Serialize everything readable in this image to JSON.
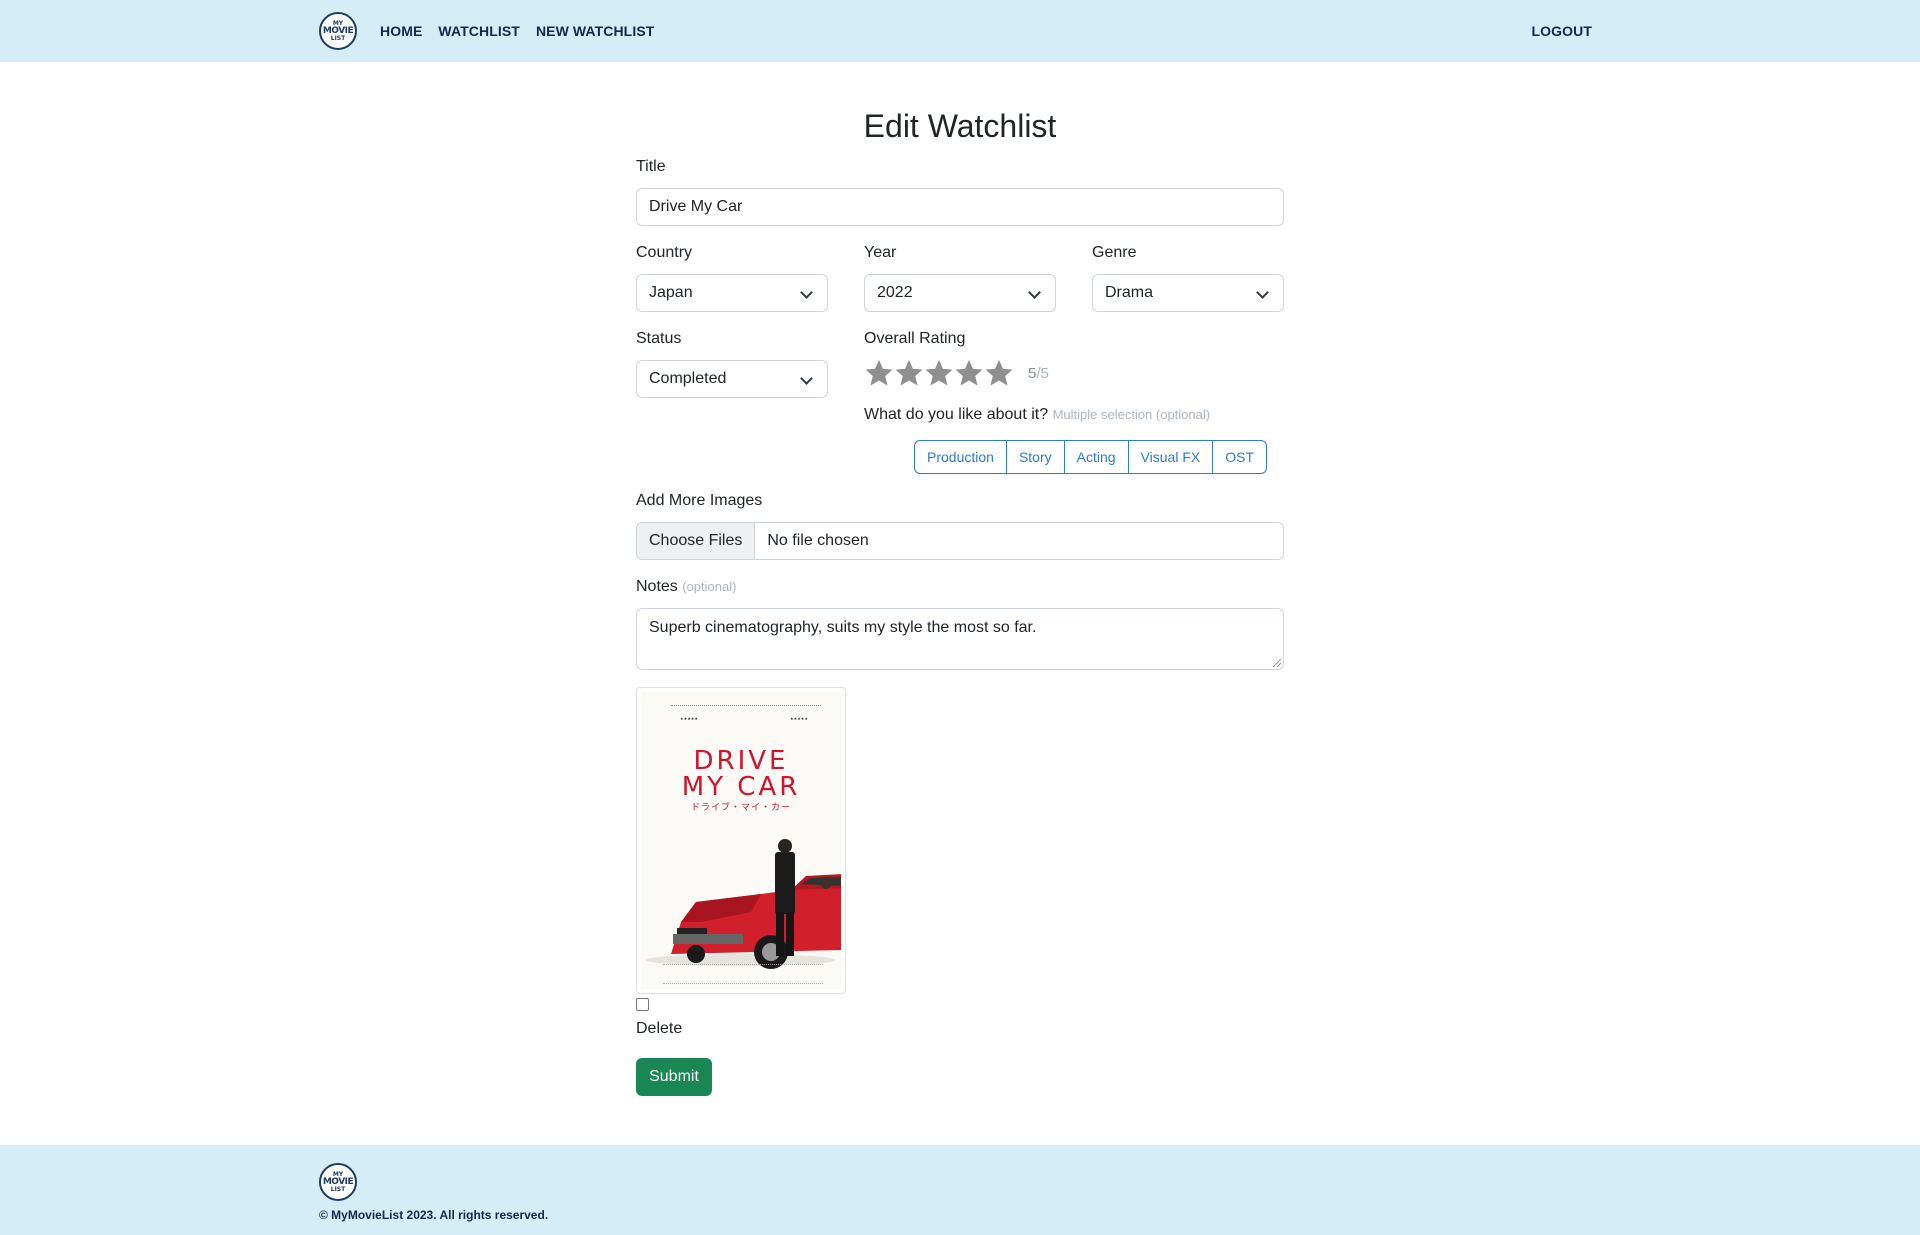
{
  "brand": {
    "logo_lines": [
      "MY",
      "MOVIE",
      "LIST"
    ]
  },
  "nav": {
    "home": "HOME",
    "watchlist": "WATCHLIST",
    "new_watchlist": "NEW WATCHLIST",
    "logout": "LOGOUT"
  },
  "page": {
    "title": "Edit Watchlist"
  },
  "form": {
    "title_label": "Title",
    "title_value": "Drive My Car",
    "country_label": "Country",
    "country_value": "Japan",
    "year_label": "Year",
    "year_value": "2022",
    "genre_label": "Genre",
    "genre_value": "Drama",
    "status_label": "Status",
    "status_value": "Completed",
    "rating_label": "Overall Rating",
    "rating": {
      "value": 5,
      "max": 5,
      "value_text": "5",
      "max_text": "/5"
    },
    "likes_label": "What do you like about it?",
    "likes_hint": "Multiple selection (optional)",
    "likes_options": [
      "Production",
      "Story",
      "Acting",
      "Visual FX",
      "OST"
    ],
    "images_label": "Add More Images",
    "file_button": "Choose Files",
    "file_status": "No file chosen",
    "notes_label": "Notes",
    "notes_hint": "(optional)",
    "notes_value": "Superb cinematography, suits my style the most so far.",
    "image": {
      "title_line1": "DRIVE",
      "title_line2": "MY CAR",
      "subtitle_jp": "ドライブ・マイ・カー",
      "delete_label": "Delete",
      "delete_checked": false
    },
    "submit_label": "Submit"
  },
  "footer": {
    "copyright": "© MyMovieList 2023. All rights reserved."
  },
  "colors": {
    "nav_bg": "#d4edf7",
    "accent": "#2f7ad6",
    "submit": "#198754",
    "poster_red": "#d0142b"
  }
}
